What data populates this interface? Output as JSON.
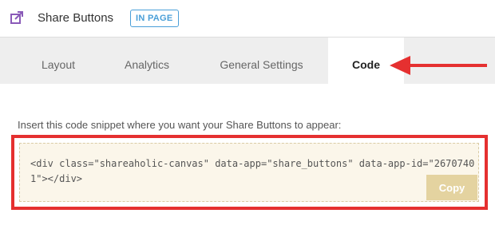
{
  "header": {
    "icon": "share-icon",
    "title": "Share Buttons",
    "badge": "IN PAGE"
  },
  "tabs": [
    {
      "label": "Layout",
      "active": false
    },
    {
      "label": "Analytics",
      "active": false
    },
    {
      "label": "General Settings",
      "active": false
    },
    {
      "label": "Code",
      "active": true
    }
  ],
  "code_panel": {
    "instruction": "Insert this code snippet where you want your Share Buttons to appear:",
    "snippet": "<div class=\"shareaholic-canvas\" data-app=\"share_buttons\" data-app-id=\"26707401\"></div>",
    "copy_label": "Copy"
  },
  "colors": {
    "accent": "#4a9fd8",
    "annotation": "#e53030",
    "copy_button": "#e4d3a0",
    "code_background": "#fbf6ea"
  }
}
